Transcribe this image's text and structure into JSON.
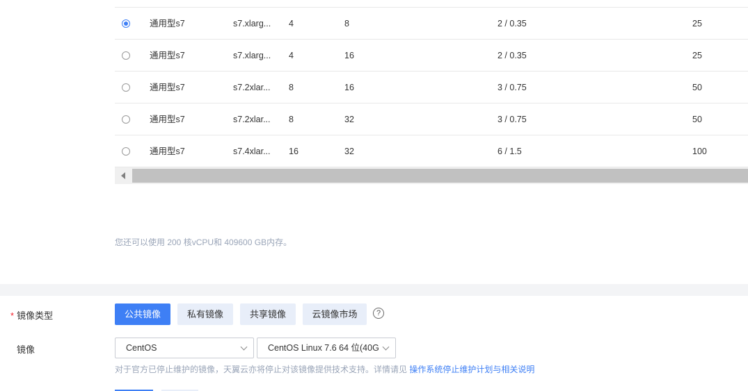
{
  "table": {
    "rows": [
      {
        "selected": true,
        "type": "通用型s7",
        "spec": "s7.xlarg...",
        "vcpu": "4",
        "mem": "8",
        "bandwidth": "2 / 0.35",
        "pps": "25"
      },
      {
        "selected": false,
        "type": "通用型s7",
        "spec": "s7.xlarg...",
        "vcpu": "4",
        "mem": "16",
        "bandwidth": "2 / 0.35",
        "pps": "25"
      },
      {
        "selected": false,
        "type": "通用型s7",
        "spec": "s7.2xlar...",
        "vcpu": "8",
        "mem": "16",
        "bandwidth": "3 / 0.75",
        "pps": "50"
      },
      {
        "selected": false,
        "type": "通用型s7",
        "spec": "s7.2xlar...",
        "vcpu": "8",
        "mem": "32",
        "bandwidth": "3 / 0.75",
        "pps": "50"
      },
      {
        "selected": false,
        "type": "通用型s7",
        "spec": "s7.4xlar...",
        "vcpu": "16",
        "mem": "32",
        "bandwidth": "6 / 1.5",
        "pps": "100"
      }
    ]
  },
  "quota_text": "您还可以使用 200 核vCPU和 409600 GB内存。",
  "image_type": {
    "required_mark": "*",
    "label": "镜像类型",
    "options": [
      "公共镜像",
      "私有镜像",
      "共享镜像",
      "云镜像市场"
    ],
    "active_index": 0,
    "help_icon": "?"
  },
  "image": {
    "label": "镜像",
    "os_select": "CentOS",
    "version_select": "CentOS Linux 7.6 64 位(40G"
  },
  "note": {
    "text": "对于官方已停止维护的镜像，天翼云亦将停止对该镜像提供技术支持。详情请见",
    "link": "操作系统停止维护计划与相关说明"
  },
  "colors": {
    "accent": "#3e7ff5",
    "muted": "#9aa5b8"
  }
}
